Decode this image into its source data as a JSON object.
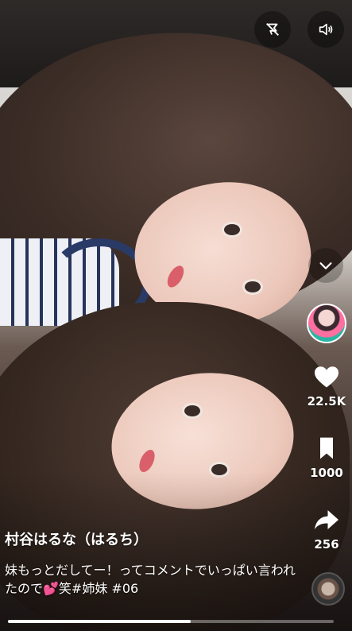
{
  "top_controls": {
    "feed_mode_icon": "no-feed-icon",
    "sound_icon": "speaker-icon"
  },
  "sidebar": {
    "collapse_icon": "chevron-down-icon",
    "likes": {
      "icon": "heart-icon",
      "count": "22.5K"
    },
    "saves": {
      "icon": "bookmark-icon",
      "count": "1000"
    },
    "shares": {
      "icon": "share-icon",
      "count": "256"
    }
  },
  "post": {
    "author": "村谷はるな（はるち）",
    "caption": "妹もっとだしてー！ってコメントでいっぱい言われたので💕笑#姉妹 #06"
  },
  "progress": {
    "fraction": 0.56
  },
  "colors": {
    "text": "#ffffff",
    "progress_track": "rgba(255,255,255,0.35)",
    "progress_fill": "#ffffff"
  }
}
